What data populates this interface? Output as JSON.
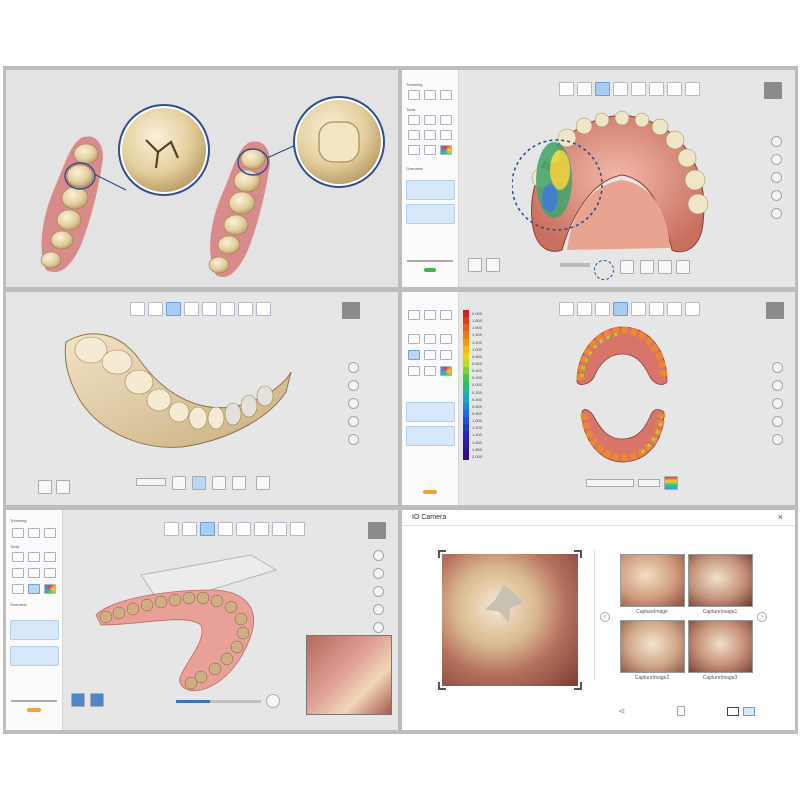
{
  "panel2": {
    "sidebar_heading": "Trimming",
    "tools_heading": "Tools",
    "overview_heading": "Overview"
  },
  "panel4": {
    "color_scale": [
      "2.000",
      "1.800",
      "1.600",
      "1.400",
      "1.200",
      "1.000",
      "0.800",
      "0.600",
      "0.400",
      "0.200",
      "0.000",
      "0.200",
      "0.400",
      "0.600",
      "0.800",
      "1.000",
      "1.200",
      "1.400",
      "1.600",
      "1.800",
      "2.000"
    ],
    "scale_colors": [
      "#d62020",
      "#e03a1c",
      "#ea5a1a",
      "#f07a18",
      "#f59a16",
      "#f8bb15",
      "#e9d31a",
      "#b8db23",
      "#7dd431",
      "#48c84b",
      "#2bbd6c",
      "#22b2a1",
      "#1ca1c8",
      "#1a86df",
      "#1b6ae6",
      "#1e4fe0",
      "#2339d1",
      "#2726bf",
      "#2f18a8",
      "#35118f",
      "#3a0c7a"
    ]
  },
  "panel5": {
    "sidebar_heading": "Trimming",
    "tools_heading": "Tools",
    "overview_heading": "Overview"
  },
  "camera": {
    "title": "IO Camera",
    "close_label": "×",
    "captures": [
      "CaptureImage",
      "CaptureImage1",
      "CaptureImage2",
      "CaptureImage3"
    ]
  },
  "colors": {
    "accent_blue": "#a9ccf3",
    "highlight_orange": "#f0a53a",
    "confirm_green": "#3fb34f"
  }
}
